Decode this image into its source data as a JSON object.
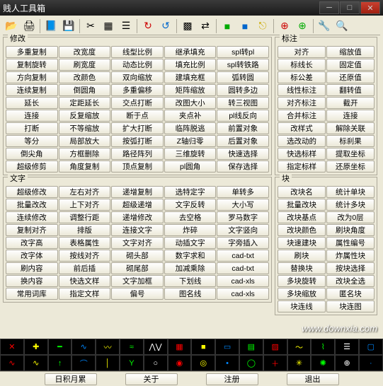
{
  "titlebar": {
    "title": "贱人工具箱"
  },
  "toolbar_icons": [
    "folder-open",
    "print",
    "book",
    "floppy",
    "cut",
    "layers",
    "organize",
    "refresh-red",
    "refresh-blue",
    "grid-color",
    "swap",
    "green-square",
    "blue-square",
    "yellow-exit",
    "db-red",
    "db-green",
    "wrench",
    "magnifier"
  ],
  "groups": {
    "modify": {
      "label": "修改",
      "buttons": [
        "多重复制",
        "改宽度",
        "线型比例",
        "继承填充",
        "spl转pl",
        "复制旋转",
        "刷宽度",
        "动态比例",
        "填充比例",
        "spl转铁路",
        "方向复制",
        "改颜色",
        "双向缩放",
        "建填充框",
        "弧转圆",
        "连续复制",
        "倒圆角",
        "多重偏移",
        "矩阵缩放",
        "圆转多边",
        "延长",
        "定距延长",
        "交点打断",
        "改图大小",
        "转三视图",
        "连接",
        "反复缩放",
        "断于点",
        "夹点补",
        "pl线反向",
        "打断",
        "不等缩放",
        "扩大打断",
        "临阵脱逃",
        "前置对象",
        "等分",
        "局部放大",
        "按弧打断",
        "Z轴归零",
        "后置对象",
        "倒尖角",
        "方框删除",
        "路径阵列",
        "三维旋转",
        "快速选择",
        "超级修剪",
        "角度复制",
        "顶点复制",
        "pl圆角",
        "保存选择"
      ]
    },
    "text": {
      "label": "文字",
      "buttons": [
        "超级修改",
        "左右对齐",
        "递增复制",
        "选特定字",
        "单转多",
        "批量改改",
        "上下对齐",
        "超级递增",
        "文字反转",
        "大小写",
        "连续修改",
        "调整行距",
        "递增修改",
        "去空格",
        "罗马数字",
        "复制对齐",
        "排版",
        "连接文字",
        "炸碎",
        "文字竖向",
        "改字高",
        "表格属性",
        "文字对齐",
        "动插文字",
        "字旁插入",
        "改字体",
        "按线对齐",
        "砌头部",
        "数字求和",
        "cad-txt",
        "刷内容",
        "前后插",
        "砌尾部",
        "加减乘除",
        "cad-txt",
        "换内容",
        "快选文样",
        "文字加框",
        "下划线",
        "cad-xls",
        "常用词库",
        "指定文样",
        "偏号",
        "图名线",
        "cad-xls"
      ]
    },
    "annotation": {
      "label": "标注",
      "buttons": [
        "对齐",
        "缩放值",
        "标线长",
        "固定值",
        "标公差",
        "还原值",
        "线性标注",
        "翻转值",
        "对齐标注",
        "截开",
        "合并标注",
        "连接",
        "改样式",
        "解除关联",
        "选改动的",
        "标刹果",
        "快选标样",
        "提取坐标",
        "指定标样",
        "还原坐标"
      ]
    },
    "block": {
      "label": "块",
      "buttons": [
        "改块名",
        "统计单块",
        "批量改块",
        "统计多块",
        "改块基点",
        "改为0层",
        "改块颜色",
        "刷块角度",
        "块速建块",
        "属性编号",
        "刷块",
        "炸属性块",
        "替换块",
        "按块选择",
        "多块旋转",
        "改块全选",
        "多块缩放",
        "匿名块",
        "块连线",
        "块连图"
      ]
    }
  },
  "icon_palette": {
    "row1": [
      "cross",
      "plus",
      "line",
      "wave1",
      "wave2",
      "wave3",
      "saw",
      "grid1",
      "box",
      "rect",
      "brick",
      "hatch",
      "wave4",
      "zigzag",
      "ladder",
      "square"
    ],
    "row2": [
      "sine",
      "sineD",
      "up",
      "arc",
      "vline",
      "tree",
      "circle",
      "spiral",
      "target",
      "dot",
      "ring",
      "plus2",
      "star",
      "wheel",
      "cross2",
      "blank"
    ]
  },
  "bottombar": {
    "b1": "日积月累",
    "b2": "关于",
    "b3": "注册",
    "b4": "退出"
  },
  "watermark": "www.downxia.com"
}
